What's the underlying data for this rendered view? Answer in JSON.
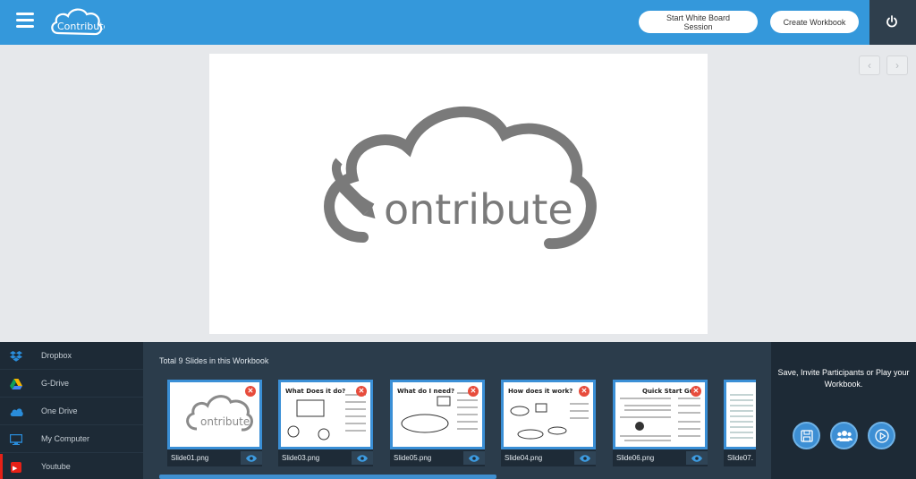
{
  "header": {
    "app_logo_text": "Contribute",
    "whiteboard_button": "Start White Board Session",
    "create_workbook_button": "Create Workbook",
    "menu_icon": "hamburger-icon",
    "power_icon": "power-icon"
  },
  "navigation": {
    "prev_label": "‹",
    "next_label": "›"
  },
  "main_slide": {
    "logo_text": "ontribute"
  },
  "sources": {
    "items": [
      {
        "label": "Dropbox",
        "icon": "dropbox-icon",
        "color": "#2a8ddb"
      },
      {
        "label": "G-Drive",
        "icon": "gdrive-icon",
        "color": "#f4b400"
      },
      {
        "label": "One Drive",
        "icon": "onedrive-icon",
        "color": "#2a8ddb"
      },
      {
        "label": "My Computer",
        "icon": "monitor-icon",
        "color": "#2a8ddb"
      },
      {
        "label": "Youtube",
        "icon": "youtube-icon",
        "color": "#e62117"
      }
    ]
  },
  "slides": {
    "title": "Total 9 Slides in this Workbook",
    "items": [
      {
        "name": "Slide01.png",
        "heading": "ontribute"
      },
      {
        "name": "Slide03.png",
        "heading": "What Does it do?"
      },
      {
        "name": "Slide05.png",
        "heading": "What do I need?"
      },
      {
        "name": "Slide04.png",
        "heading": "How does it work?"
      },
      {
        "name": "Slide06.png",
        "heading": "Quick Start Gu"
      },
      {
        "name": "Slide07.",
        "heading": ""
      }
    ]
  },
  "actions": {
    "text": "Save, Invite Participants or Play your Workbook.",
    "save_icon": "save-icon",
    "invite_icon": "users-icon",
    "play_icon": "play-icon"
  },
  "colors": {
    "header": "#3498db",
    "sidebar": "#1d2a36",
    "strip": "#2b3c4b",
    "accent": "#3d8fd4",
    "delete": "#e74c3c"
  }
}
